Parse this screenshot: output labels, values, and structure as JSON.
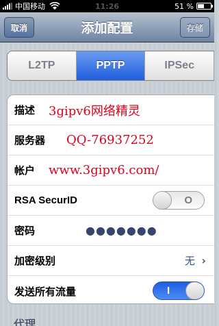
{
  "status_bar": {
    "carrier": "中国移动",
    "time": "11:26",
    "battery": "51 %"
  },
  "nav": {
    "cancel_label": "取消",
    "title": "添加配置",
    "save_label": "存储"
  },
  "segments": [
    {
      "label": "L2TP",
      "selected": false
    },
    {
      "label": "PPTP",
      "selected": true
    },
    {
      "label": "IPSec",
      "selected": false
    }
  ],
  "form": {
    "description": {
      "label": "描述",
      "value": "3gipv6网络精灵"
    },
    "server": {
      "label": "服务器",
      "value": "QQ-76937252"
    },
    "account": {
      "label": "帐户",
      "value": "www.3gipv6.com/"
    },
    "rsa_securid": {
      "label": "RSA SecurID",
      "toggle_text": "O",
      "on": false
    },
    "password": {
      "label": "密码",
      "value": "●●●●●●●"
    },
    "encryption": {
      "label": "加密级别",
      "value": "无"
    },
    "send_all_traffic": {
      "label": "发送所有流量",
      "toggle_text": "I",
      "on": true
    }
  },
  "proxy_section": {
    "label": "代理"
  }
}
